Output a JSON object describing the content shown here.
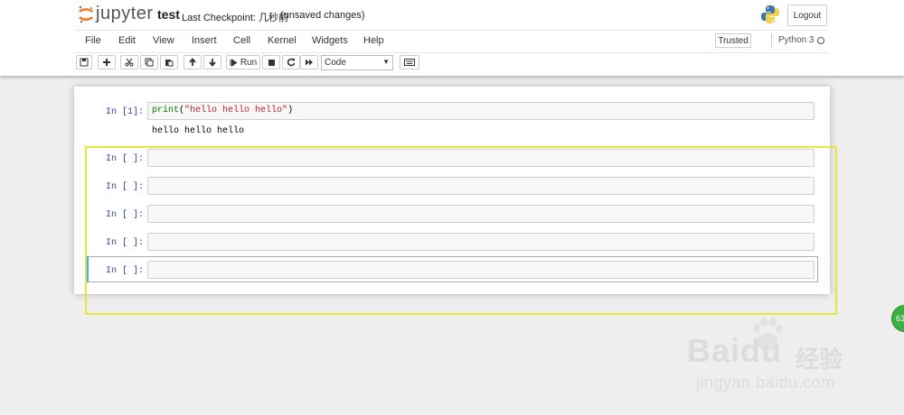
{
  "app": {
    "logo_text": "jupyter",
    "notebook_name": "test",
    "checkpoint": "Last Checkpoint: 几秒前",
    "unsaved": "(unsaved changes)",
    "logout_label": "Logout"
  },
  "menu": {
    "items": [
      "File",
      "Edit",
      "View",
      "Insert",
      "Cell",
      "Kernel",
      "Widgets",
      "Help"
    ],
    "trusted": "Trusted",
    "kernel": "Python 3"
  },
  "toolbar": {
    "run_label": "Run",
    "cell_type": "Code",
    "icons": [
      "save-icon",
      "plus-icon",
      "cut-icon",
      "copy-icon",
      "paste-icon",
      "arrow-up-icon",
      "arrow-down-icon",
      "run-icon",
      "stop-icon",
      "restart-icon",
      "fast-forward-icon",
      "keyboard-icon"
    ]
  },
  "cells": [
    {
      "prompt": "In [1]:",
      "code_fn": "print",
      "code_str": "\"hello hello hello\"",
      "output": "hello hello hello"
    },
    {
      "prompt": "In [ ]:",
      "code": ""
    },
    {
      "prompt": "In [ ]:",
      "code": ""
    },
    {
      "prompt": "In [ ]:",
      "code": ""
    },
    {
      "prompt": "In [ ]:",
      "code": ""
    },
    {
      "prompt": "In [ ]:",
      "code": ""
    }
  ],
  "overlay": {
    "notification_count": "63",
    "watermark_logo": "Baidu",
    "watermark_cn": "经验",
    "watermark_url": "jingyan.baidu.com"
  },
  "colors": {
    "prompt": "#303f9f",
    "highlight_box": "#e6e63c",
    "python_keyword": "#008000",
    "python_string": "#ba2121"
  }
}
